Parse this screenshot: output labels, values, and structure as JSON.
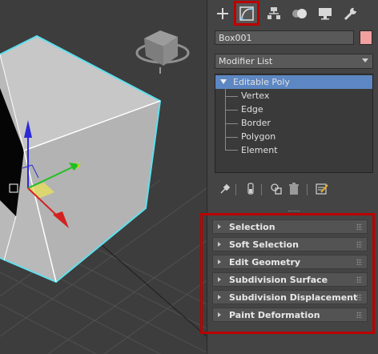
{
  "command_panel": {
    "tabs": [
      {
        "name": "create",
        "icon": "plus-icon"
      },
      {
        "name": "modify",
        "icon": "modify-curve-icon",
        "active": true
      },
      {
        "name": "hierarchy",
        "icon": "hierarchy-icon"
      },
      {
        "name": "motion",
        "icon": "motion-icon"
      },
      {
        "name": "display",
        "icon": "monitor-icon"
      },
      {
        "name": "utilities",
        "icon": "wrench-icon"
      }
    ],
    "object_name": "Box001",
    "object_color": "#f2a0a0",
    "modifier_list_label": "Modifier List",
    "stack": {
      "root": "Editable Poly",
      "sub_objects": [
        "Vertex",
        "Edge",
        "Border",
        "Polygon",
        "Element"
      ]
    },
    "stack_tools": [
      "pin-stack-icon",
      "show-end-result-icon",
      "make-unique-icon",
      "remove-modifier-icon",
      "configure-modifier-sets-icon"
    ],
    "rollouts": [
      "Selection",
      "Soft Selection",
      "Edit Geometry",
      "Subdivision Surface",
      "Subdivision Displacement",
      "Paint Deformation"
    ]
  },
  "viewport": {
    "axis_labels": {
      "y": "y"
    },
    "colors": {
      "selection_wire": "#5ee0ee",
      "highlight": "#b00000",
      "x_axis": "#d42020",
      "y_axis": "#21c021",
      "z_axis": "#2a2ad8"
    }
  }
}
